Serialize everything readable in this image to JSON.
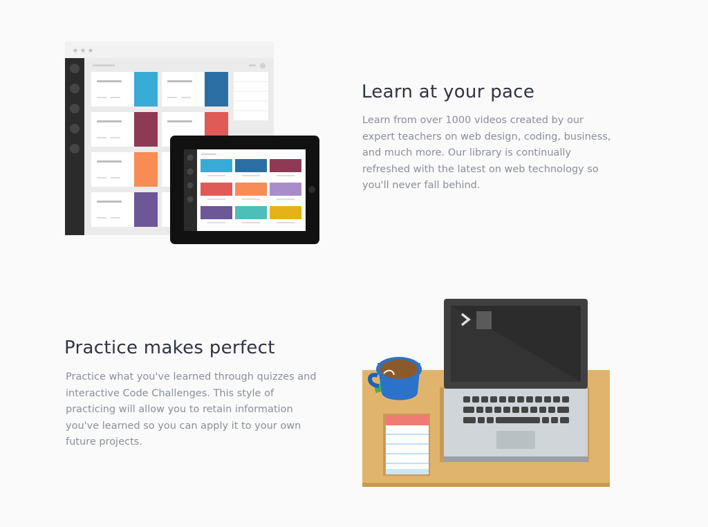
{
  "section_pace": {
    "title": "Learn at your pace",
    "body": "Learn from over 1000 videos created by our\nexpert teachers on web design, coding, business,\nand much more. Our library is continually\nrefreshed with the latest on web technology so\nyou'll never fall behind."
  },
  "section_practice": {
    "title": "Practice makes perfect",
    "body": "Practice what you've learned through quizzes and\ninteractive Code Challenges. This style of\npracticing will allow you to retain information\nyou've learned so you can apply it to your own\nfuture projects."
  },
  "colors": {
    "heading": "#2f3440",
    "body_text": "#8a8f98",
    "tile_blue": "#37abd6",
    "tile_navy": "#2b6ea4",
    "tile_maroon": "#8f3a55",
    "tile_red": "#e05a57",
    "tile_orange": "#f78c55",
    "tile_purple": "#6d5796",
    "tile_lavender": "#a98dca",
    "tile_teal": "#4dbfb8",
    "tile_yellow": "#e6b21a",
    "desk": "#e1b46d"
  }
}
